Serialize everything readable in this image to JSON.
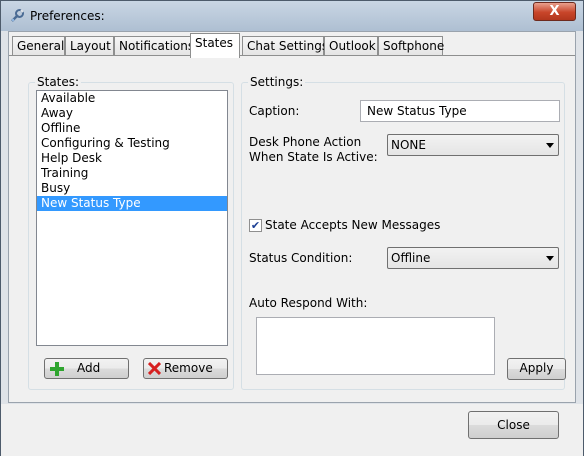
{
  "window": {
    "title": "Preferences:",
    "close_glyph": "X"
  },
  "tabs": [
    {
      "label": "General"
    },
    {
      "label": "Layout"
    },
    {
      "label": "Notifications"
    },
    {
      "label": "States"
    },
    {
      "label": "Chat Settings:"
    },
    {
      "label": "Outlook"
    },
    {
      "label": "Softphone"
    }
  ],
  "active_tab": "States",
  "states_panel": {
    "label": "States:",
    "items": [
      "Available",
      "Away",
      "Offline",
      "Configuring & Testing",
      "Help Desk",
      "Training",
      "Busy",
      "New Status Type"
    ],
    "selected": "New Status Type",
    "add_label": "Add",
    "remove_label": "Remove"
  },
  "settings_panel": {
    "label": "Settings:",
    "caption_label": "Caption:",
    "caption_value": "New Status Type",
    "desk_phone_label_line1": "Desk Phone Action",
    "desk_phone_label_line2": "When State Is Active:",
    "desk_phone_value": "NONE",
    "accepts_messages_label": "State Accepts New Messages",
    "accepts_messages_checked": true,
    "status_condition_label": "Status Condition:",
    "status_condition_value": "Offline",
    "auto_respond_label": "Auto Respond With:",
    "auto_respond_value": "",
    "apply_label": "Apply"
  },
  "footer": {
    "close_label": "Close"
  },
  "colors": {
    "selection": "#3399ff",
    "add_icon": "#2fa52f",
    "remove_icon": "#d62020"
  }
}
